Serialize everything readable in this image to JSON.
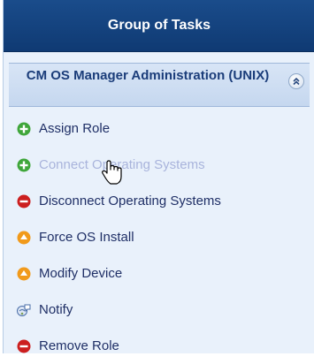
{
  "header": {
    "title": "Group of Tasks"
  },
  "group": {
    "title": "CM OS Manager Administration (UNIX)"
  },
  "tasks": [
    {
      "label": "Assign Role",
      "icon": "plus-circle-icon",
      "color": "#3fa63a",
      "enabled": true
    },
    {
      "label": "Connect Operating Systems",
      "icon": "plus-circle-icon",
      "color": "#3fa63a",
      "enabled": false
    },
    {
      "label": "Disconnect Operating Systems",
      "icon": "minus-circle-icon",
      "color": "#cc1f1f",
      "enabled": true
    },
    {
      "label": "Force OS Install",
      "icon": "up-arrow-circle-icon",
      "color": "#f19a1b",
      "enabled": true
    },
    {
      "label": "Modify Device",
      "icon": "up-arrow-circle-icon",
      "color": "#f19a1b",
      "enabled": true
    },
    {
      "label": "Notify",
      "icon": "notify-icon",
      "color": "#5a7fb8",
      "enabled": true
    },
    {
      "label": "Remove Role",
      "icon": "minus-circle-icon",
      "color": "#cc1f1f",
      "enabled": true
    }
  ],
  "colors": {
    "header_bg": "#1a4c8b",
    "panel_bg": "#e9f1fb",
    "text": "#1f2f66",
    "disabled_text": "#a9b4dc"
  }
}
